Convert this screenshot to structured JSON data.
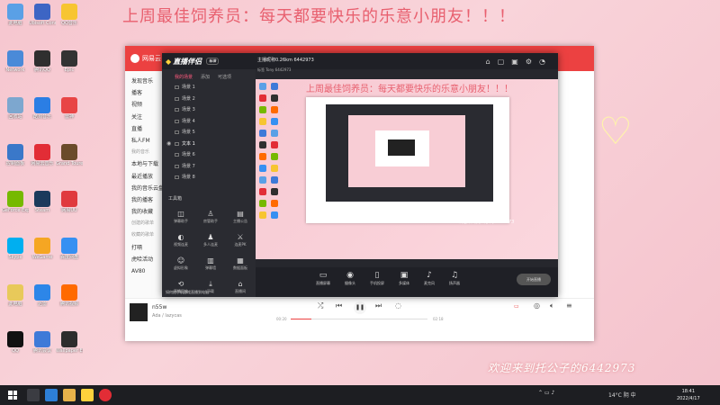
{
  "desktop": {
    "banner": "上周最佳饲养员：每天都要快乐的乐意小朋友！！！",
    "welcome": "欢迎来到托公子的6442973",
    "icons": [
      {
        "label": "此电脑",
        "color": "#5aa0e6"
      },
      {
        "label": "Network",
        "color": "#4a8ad8"
      },
      {
        "label": "回收站",
        "color": "#7da7cf"
      },
      {
        "label": "控制面板",
        "color": "#3a78c9"
      },
      {
        "label": "GeForce Experience",
        "color": "#76b900"
      },
      {
        "label": "Skype",
        "color": "#00aff0"
      },
      {
        "label": "此电脑",
        "color": "#e8c95a"
      },
      {
        "label": "QQ",
        "color": "#111111"
      },
      {
        "label": "Ubisoft Connect",
        "color": "#3d65c4"
      },
      {
        "label": "腾讯QQ",
        "color": "#2f2f2f"
      },
      {
        "label": "酷狗音乐",
        "color": "#2b7ee4"
      },
      {
        "label": "网易云音乐",
        "color": "#e22d36"
      },
      {
        "label": "Steam",
        "color": "#1b3a5c"
      },
      {
        "label": "WeGame",
        "color": "#f5a623"
      },
      {
        "label": "迅雷",
        "color": "#2d86e8"
      },
      {
        "label": "腾讯会议",
        "color": "#3e7ad8"
      },
      {
        "label": "QQ音乐",
        "color": "#f7c531"
      },
      {
        "label": "Epic",
        "color": "#333333"
      },
      {
        "label": "雷神",
        "color": "#e84545"
      },
      {
        "label": "Grand Tourer",
        "color": "#6b4b2b"
      },
      {
        "label": "网易UU",
        "color": "#e03a3e"
      },
      {
        "label": "百度网盘",
        "color": "#3690f2"
      },
      {
        "label": "腾讯视频",
        "color": "#ff6a00"
      },
      {
        "label": "Wallpaper Engine",
        "color": "#2d2d2d"
      }
    ]
  },
  "music": {
    "app_name": "网易云",
    "sidebar": [
      {
        "label": "发现音乐",
        "type": "item"
      },
      {
        "label": "播客",
        "type": "item"
      },
      {
        "label": "视频",
        "type": "item"
      },
      {
        "label": "关注",
        "type": "item"
      },
      {
        "label": "直播",
        "type": "item"
      },
      {
        "label": "私人FM",
        "type": "item"
      },
      {
        "label": "我的音乐",
        "type": "section"
      },
      {
        "label": "本地与下载",
        "type": "item"
      },
      {
        "label": "最近播放",
        "type": "item"
      },
      {
        "label": "我的音乐云盘",
        "type": "item"
      },
      {
        "label": "我的播客",
        "type": "item"
      },
      {
        "label": "我的收藏",
        "type": "item"
      },
      {
        "label": "创建的歌单",
        "type": "section"
      },
      {
        "label": "收藏的歌单",
        "type": "section"
      },
      {
        "label": "打嗝",
        "type": "item"
      },
      {
        "label": "虎哈活动",
        "type": "item"
      },
      {
        "label": "AV80",
        "type": "item"
      }
    ],
    "track_title": "n55w",
    "track_artist": "Ada / lazycas",
    "time_current": "00:20",
    "time_total": "02:18",
    "progress": 0.15
  },
  "zb": {
    "app_name": "直播伴侣",
    "badge": "标准",
    "tabs": [
      "我的场景",
      "添加",
      "可选项"
    ],
    "scenes": [
      {
        "label": "场景 1",
        "active": false
      },
      {
        "label": "场景 2",
        "active": false
      },
      {
        "label": "场景 3",
        "active": false
      },
      {
        "label": "场景 4",
        "active": false
      },
      {
        "label": "场景 5",
        "active": false
      },
      {
        "label": "文本 1",
        "active": true
      },
      {
        "label": "场景 6",
        "active": false
      },
      {
        "label": "场景 7",
        "active": false
      },
      {
        "label": "场景 8",
        "active": false
      }
    ],
    "tools_title": "工具箱",
    "tools": [
      {
        "label": "弹幕助手",
        "icon": "◫"
      },
      {
        "label": "房管助手",
        "icon": "♙"
      },
      {
        "label": "主播公告",
        "icon": "▤"
      },
      {
        "label": "视频连麦",
        "icon": "◐"
      },
      {
        "label": "多人连麦",
        "icon": "♟"
      },
      {
        "label": "连麦PK",
        "icon": "⚔"
      },
      {
        "label": "虚拟形象",
        "icon": "☺"
      },
      {
        "label": "弹幕墙",
        "icon": "▥"
      },
      {
        "label": "数据面板",
        "icon": "▦"
      },
      {
        "label": "直播回放",
        "icon": "⟲"
      },
      {
        "label": "下载",
        "icon": "⤓"
      },
      {
        "label": "直播间",
        "icon": "⌂"
      }
    ],
    "hint": "如何把手机游戏直播到电脑？",
    "room_title": "主播昵称0.26km 6442973",
    "room_tag": "直播",
    "room_sub": "标签 Tony 6442973",
    "room_hot": "773",
    "bottom": [
      {
        "label": "直播屏幕",
        "icon": "▭"
      },
      {
        "label": "摄像头",
        "icon": "◉"
      },
      {
        "label": "手机投屏",
        "icon": "▯"
      },
      {
        "label": "多媒体",
        "icon": "▣"
      },
      {
        "label": "麦克风",
        "icon": "♪"
      },
      {
        "label": "扬声器",
        "icon": "♫"
      }
    ],
    "start_label": "开始直播"
  },
  "taskbar": {
    "weather": "14°C 阴",
    "time": "18:41",
    "date": "2022/4/17",
    "lang": "中"
  }
}
